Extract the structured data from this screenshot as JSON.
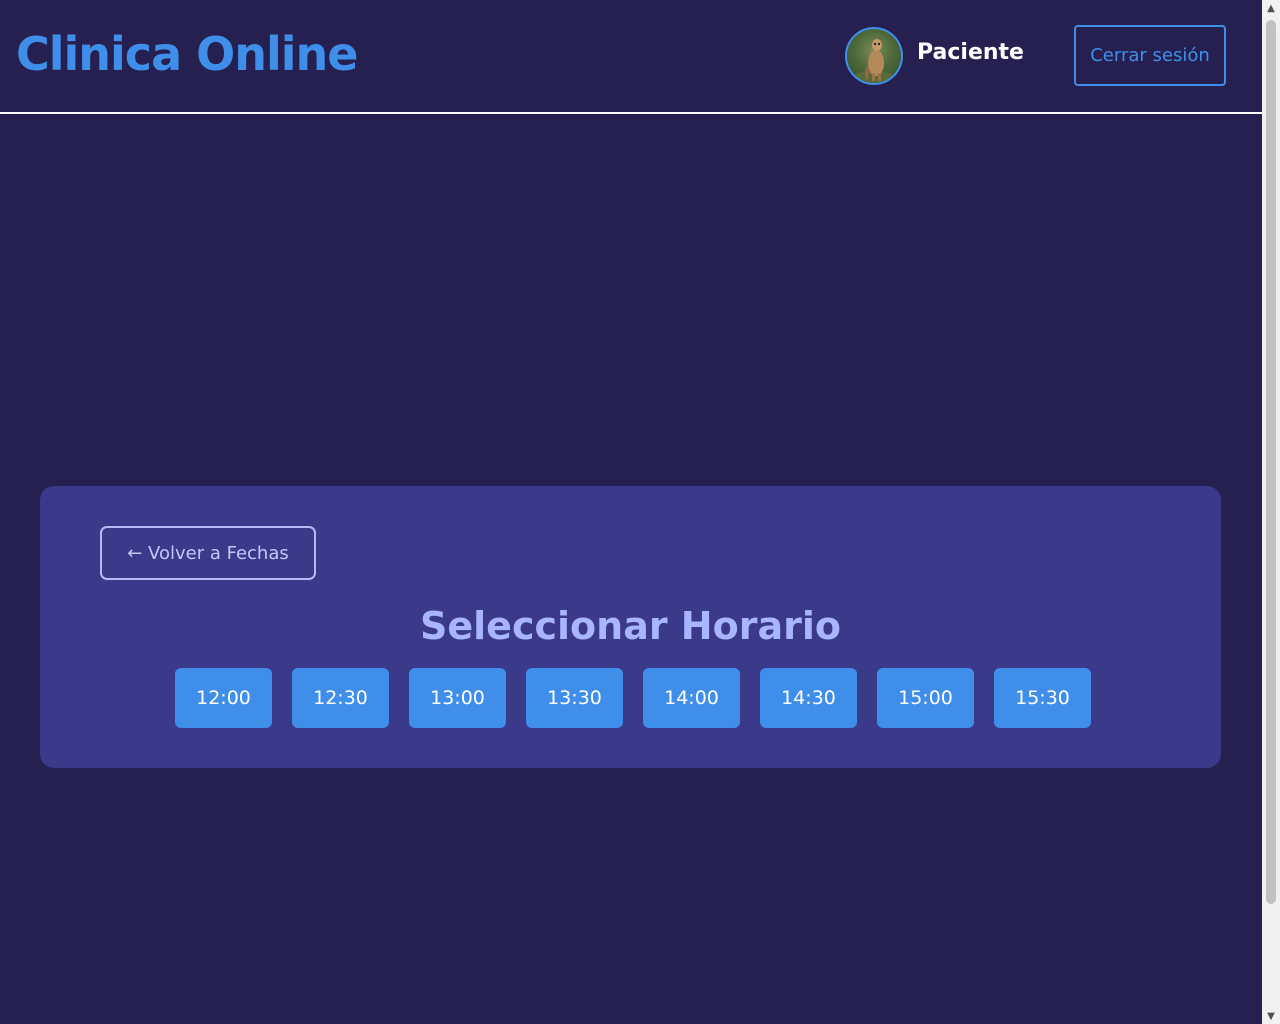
{
  "header": {
    "brand": "Clinica Online",
    "user_role": "Paciente",
    "logout_label": "Cerrar sesión",
    "avatar_icon": "meerkat-avatar-icon"
  },
  "card": {
    "back_label": "← Volver a Fechas",
    "title": "Seleccionar Horario",
    "time_slots": [
      "12:00",
      "12:30",
      "13:00",
      "13:30",
      "14:00",
      "14:30",
      "15:00",
      "15:30"
    ]
  },
  "colors": {
    "background": "#25204f",
    "card": "#3a398a",
    "accent": "#3f8fea",
    "title": "#a9b5ff"
  }
}
